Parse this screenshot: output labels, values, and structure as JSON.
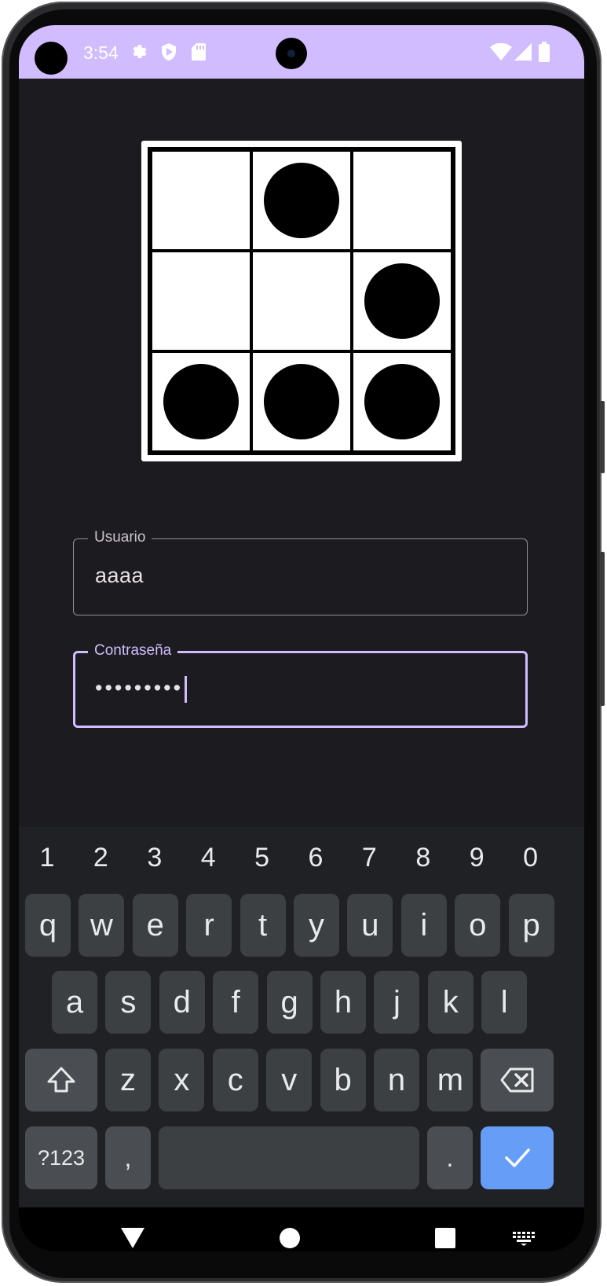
{
  "statusbar": {
    "time": "3:54",
    "left_icons": [
      "gear-icon",
      "shield-play-icon",
      "sd-card-icon"
    ],
    "right_icons": [
      "wifi-icon",
      "signal-icon",
      "battery-icon"
    ],
    "background": "#d0bcff"
  },
  "logo": {
    "icon": "glider-logo",
    "grid": [
      [
        false,
        true,
        false
      ],
      [
        false,
        false,
        true
      ],
      [
        true,
        true,
        true
      ]
    ]
  },
  "form": {
    "username": {
      "label": "Usuario",
      "value": "aaaa"
    },
    "password": {
      "label": "Contraseña",
      "value": "•••••••••"
    }
  },
  "keyboard": {
    "numbers": [
      "1",
      "2",
      "3",
      "4",
      "5",
      "6",
      "7",
      "8",
      "9",
      "0"
    ],
    "row1": [
      "q",
      "w",
      "e",
      "r",
      "t",
      "y",
      "u",
      "i",
      "o",
      "p"
    ],
    "row2": [
      "a",
      "s",
      "d",
      "f",
      "g",
      "h",
      "j",
      "k",
      "l"
    ],
    "row3": [
      "z",
      "x",
      "c",
      "v",
      "b",
      "n",
      "m"
    ],
    "symbols_label": "?123",
    "comma_label": ",",
    "period_label": ".",
    "colors": {
      "accent": "#669df6",
      "key": "#3c4043",
      "background": "#202124"
    }
  },
  "navbar": {
    "icons": [
      "back-icon",
      "home-icon",
      "recents-icon",
      "keyboard-switch-icon"
    ]
  }
}
